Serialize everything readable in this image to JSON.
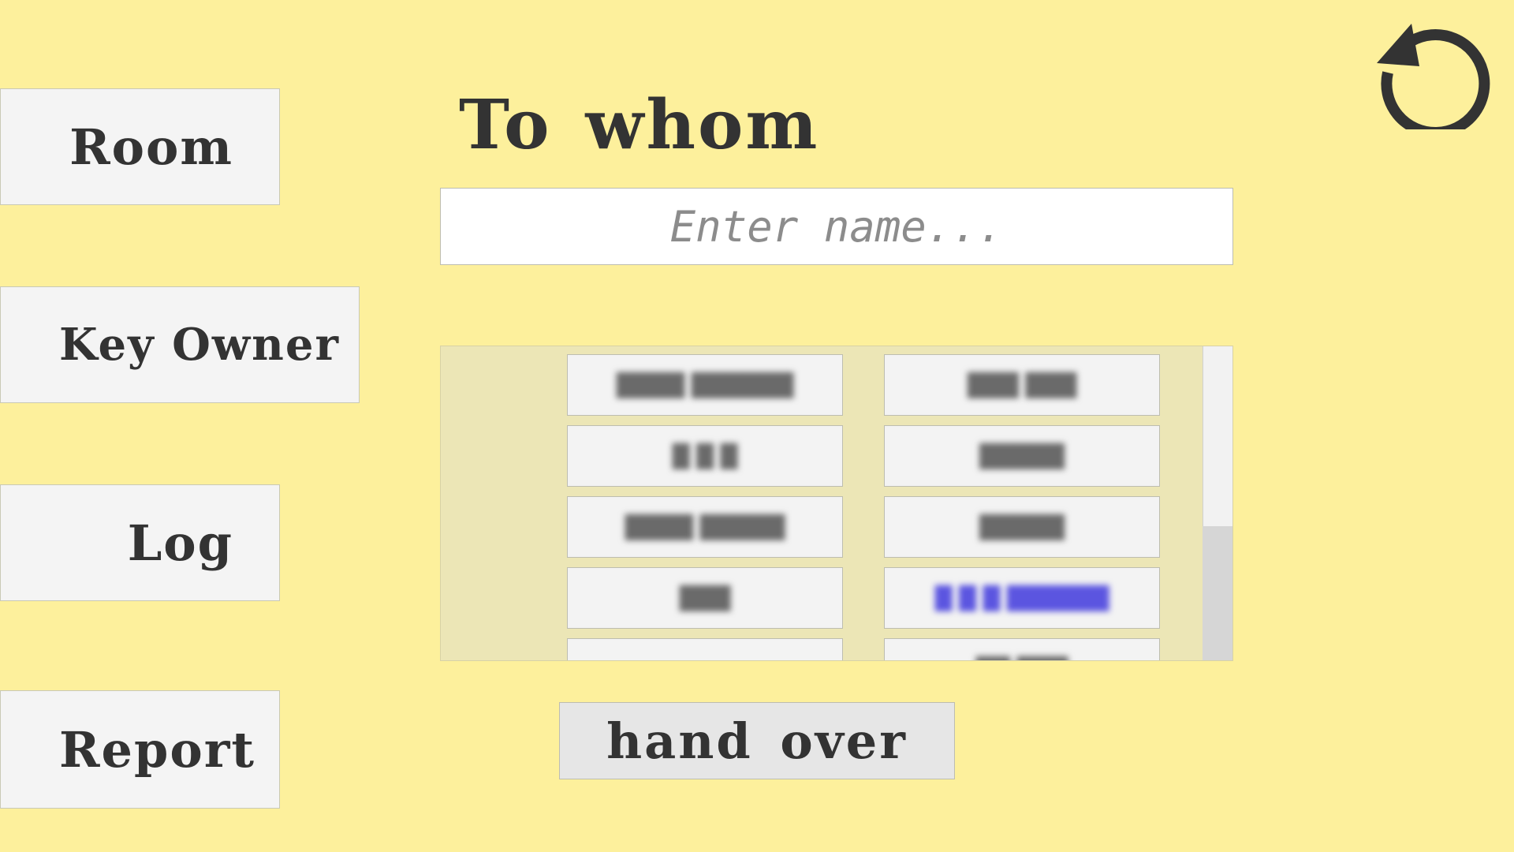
{
  "nav": {
    "room_label": "Room",
    "key_owner_label": "Key Owner",
    "log_label": "Log",
    "report_label": "Report"
  },
  "title": "To whom",
  "search": {
    "placeholder": "Enter name...",
    "value": ""
  },
  "names": [
    {
      "text": "████ ██████",
      "style": "normal"
    },
    {
      "text": "███ ███",
      "style": "normal"
    },
    {
      "text": "█ █ █",
      "style": "normal"
    },
    {
      "text": "█████",
      "style": "normal"
    },
    {
      "text": "████ █████",
      "style": "normal"
    },
    {
      "text": "█████",
      "style": "normal"
    },
    {
      "text": "███",
      "style": "normal"
    },
    {
      "text": "█ █ █ ██████",
      "style": "link"
    },
    {
      "text": "",
      "style": "normal"
    },
    {
      "text": "██ ███",
      "style": "normal"
    }
  ],
  "action": {
    "hand_over_label": "hand over"
  },
  "icons": {
    "refresh": "refresh-icon"
  },
  "colors": {
    "background": "#fdf09c",
    "button": "#f4f4f4",
    "text": "#333333",
    "list_panel": "#ece6b6"
  }
}
